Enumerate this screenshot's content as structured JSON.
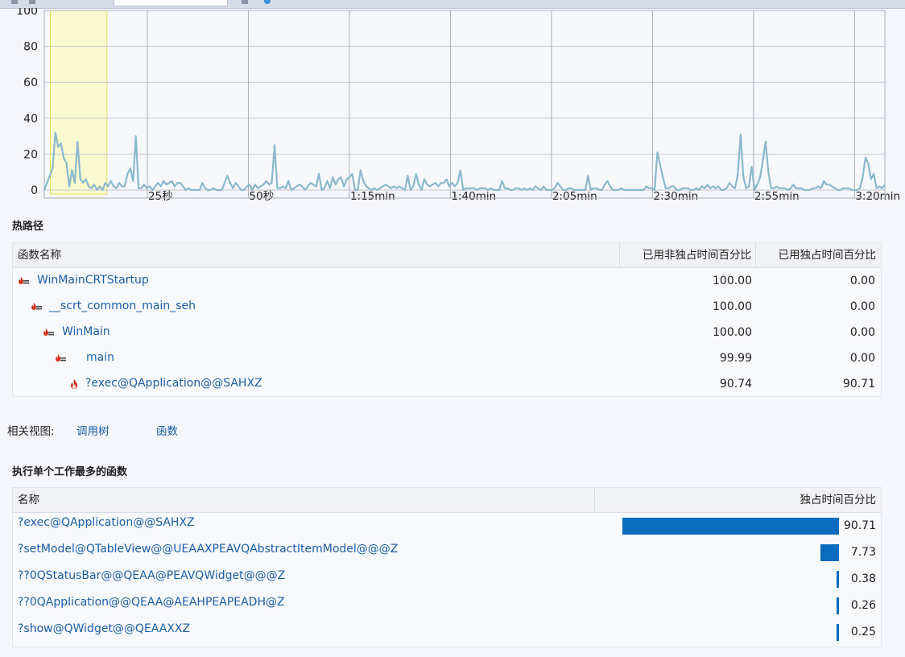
{
  "chart_data": {
    "type": "line",
    "y_ticks": [
      0,
      20,
      40,
      60,
      80,
      100
    ],
    "ylim": [
      0,
      100
    ],
    "x_ticks": [
      "25秒",
      "50秒",
      "1:15min",
      "1:40min",
      "2:05min",
      "2:30min",
      "2:55min",
      "3:20min"
    ],
    "x_tick_seconds": [
      25,
      50,
      75,
      100,
      125,
      150,
      175,
      200
    ],
    "xlim_seconds": [
      -0.5,
      207.5
    ],
    "selection_seconds": [
      1,
      15
    ],
    "series_color": "#8ab8cc",
    "selection_color": "#fafad0",
    "series": [
      {
        "values": [
          0,
          4,
          8,
          12,
          32,
          24,
          26,
          18,
          15,
          2,
          11,
          4,
          27,
          6,
          4,
          6,
          2,
          1,
          3,
          0,
          2,
          0,
          4,
          2,
          5,
          2,
          1,
          4,
          2,
          2,
          9,
          12,
          5,
          30,
          1,
          1,
          3,
          1,
          2,
          0,
          2,
          4,
          2,
          5,
          3,
          4,
          5,
          2,
          4,
          4,
          2,
          0,
          1,
          0,
          0,
          0,
          0,
          4,
          1,
          0,
          0,
          1,
          0,
          0,
          0,
          4,
          8,
          4,
          1,
          4,
          2,
          0,
          0,
          2,
          3,
          0,
          3,
          1,
          2,
          3,
          5,
          3,
          4,
          25,
          1,
          1,
          2,
          1,
          5,
          0,
          1,
          2,
          3,
          2,
          0,
          2,
          4,
          3,
          2,
          9,
          0,
          1,
          5,
          1,
          7,
          3,
          6,
          7,
          2,
          6,
          7,
          9,
          0,
          0,
          11,
          5,
          2,
          1,
          0,
          1,
          0,
          1,
          2,
          3,
          2,
          1,
          2,
          1,
          2,
          1,
          0,
          8,
          0,
          2,
          9,
          3,
          0,
          6,
          3,
          2,
          3,
          4,
          2,
          4,
          4,
          6,
          2,
          4,
          2,
          4,
          11,
          0,
          1,
          1,
          1,
          1,
          0,
          1,
          1,
          1,
          0,
          1,
          0,
          0,
          0,
          5,
          1,
          1,
          0,
          0,
          1,
          1,
          0,
          1,
          0,
          1,
          0,
          2,
          1,
          0,
          2,
          0,
          0,
          0,
          1,
          4,
          2,
          0,
          0,
          1,
          1,
          0,
          0,
          0,
          0,
          0,
          8,
          0,
          1,
          1,
          0,
          0,
          3,
          5,
          2,
          0,
          0,
          0,
          1,
          0,
          0,
          0,
          0,
          0,
          0,
          0,
          0,
          2,
          1,
          1,
          0,
          21,
          14,
          7,
          1,
          1,
          2,
          2,
          0,
          0,
          1,
          1,
          1,
          0,
          0,
          1,
          0,
          2,
          1,
          3,
          1,
          2,
          1,
          2,
          0,
          0,
          1,
          4,
          2,
          1,
          9,
          31,
          7,
          1,
          2,
          13,
          0,
          3,
          7,
          16,
          27,
          10,
          1,
          1,
          2,
          1,
          1,
          1,
          0,
          1,
          3,
          1,
          1,
          1,
          0,
          0,
          0,
          1,
          1,
          2,
          1,
          5,
          3,
          3,
          2,
          1,
          0,
          0,
          1,
          1,
          1,
          0,
          0,
          0,
          1,
          7,
          18,
          15,
          6,
          9,
          1,
          2,
          1,
          3
        ]
      }
    ]
  },
  "hot_path": {
    "title": "热路径",
    "headers": {
      "name": "函数名称",
      "inclusive": "已用非独占时间百分比",
      "exclusive": "已用独占时间百分比"
    },
    "rows": [
      {
        "name": "WinMainCRTStartup",
        "inclusive": "100.00",
        "exclusive": "0.00",
        "icon": "hot-path-icon"
      },
      {
        "name": "__scrt_common_main_seh",
        "inclusive": "100.00",
        "exclusive": "0.00",
        "icon": "hot-path-icon"
      },
      {
        "name": "WinMain",
        "inclusive": "100.00",
        "exclusive": "0.00",
        "icon": "hot-path-icon"
      },
      {
        "name": "main",
        "inclusive": "99.99",
        "exclusive": "0.00",
        "icon": "hot-path-icon"
      },
      {
        "name": "?exec@QApplication@@SAHXZ",
        "inclusive": "90.74",
        "exclusive": "90.71",
        "icon": "flame-icon"
      }
    ]
  },
  "related_views": {
    "label": "相关视图:",
    "call_tree": "调用树",
    "functions": "函数"
  },
  "top_functions": {
    "title": "执行单个工作最多的函数",
    "headers": {
      "name": "名称",
      "exclusive": "独占时间百分比"
    },
    "rows": [
      {
        "name": "?exec@QApplication@@SAHXZ",
        "value": 90.71,
        "label": "90.71"
      },
      {
        "name": "?setModel@QTableView@@UEAAXPEAVQAbstractItemModel@@@Z",
        "value": 7.73,
        "label": "7.73"
      },
      {
        "name": "??0QStatusBar@@QEAA@PEAVQWidget@@@Z",
        "value": 0.38,
        "label": "0.38"
      },
      {
        "name": "??0QApplication@@QEAA@AEAHPEAPEADH@Z",
        "value": 0.26,
        "label": "0.26"
      },
      {
        "name": "?show@QWidget@@QEAAXXZ",
        "value": 0.25,
        "label": "0.25"
      }
    ],
    "bar_color": "#0a6bbf"
  }
}
